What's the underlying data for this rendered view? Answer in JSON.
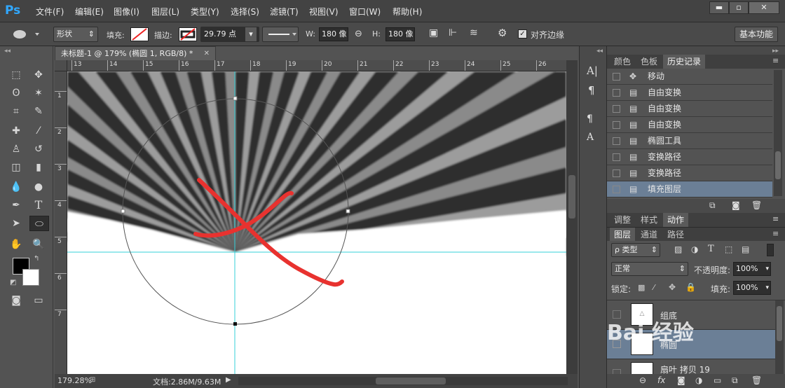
{
  "app": {
    "logo": "Ps"
  },
  "menu": [
    "文件(F)",
    "编辑(E)",
    "图像(I)",
    "图层(L)",
    "类型(Y)",
    "选择(S)",
    "滤镜(T)",
    "视图(V)",
    "窗口(W)",
    "帮助(H)"
  ],
  "window_controls": {
    "minimize": "▬",
    "maximize": "▫",
    "close": "✕"
  },
  "options": {
    "mode": "形状",
    "fill_label": "填充:",
    "stroke_label": "描边:",
    "stroke_width": "29.79 点",
    "w_label": "W:",
    "w_value": "180 像",
    "h_label": "H:",
    "h_value": "180 像",
    "align_edges": "对齐边缘",
    "workspace": "基本功能"
  },
  "document": {
    "tab_title": "未标题-1 @ 179% (椭圆 1, RGB/8) *",
    "ruler_top": [
      "13",
      "14",
      "15",
      "16",
      "17",
      "18",
      "19",
      "20",
      "21",
      "22",
      "23",
      "24",
      "25",
      "26"
    ],
    "ruler_left": [
      "1",
      "2",
      "3",
      "4",
      "5",
      "6",
      "7"
    ]
  },
  "status": {
    "zoom": "179.28%",
    "doc_info": "文档:2.86M/9.63M"
  },
  "panels": {
    "top_tabs": [
      "颜色",
      "色板",
      "历史记录"
    ],
    "history": [
      "移动",
      "自由变换",
      "自由变换",
      "自由变换",
      "椭圆工具",
      "变换路径",
      "变换路径",
      "填充图层"
    ],
    "mid_tabs": [
      "调整",
      "样式",
      "动作"
    ],
    "layer_tabs": [
      "图层",
      "通道",
      "路径"
    ],
    "filter_kind": "ρ 类型",
    "blend_mode": "正常",
    "opacity_label": "不透明度:",
    "opacity_value": "100%",
    "lock_label": "锁定:",
    "fill_label": "填充:",
    "fill_value": "100%",
    "layers": [
      "组底",
      "椭圆",
      "扇叶 拷贝 19"
    ]
  },
  "watermark": "Bai 经验",
  "colors": {
    "accent": "#31a8ff",
    "selection": "#6b7f96",
    "annotation": "#e8322f",
    "guide": "#35d0d8"
  }
}
